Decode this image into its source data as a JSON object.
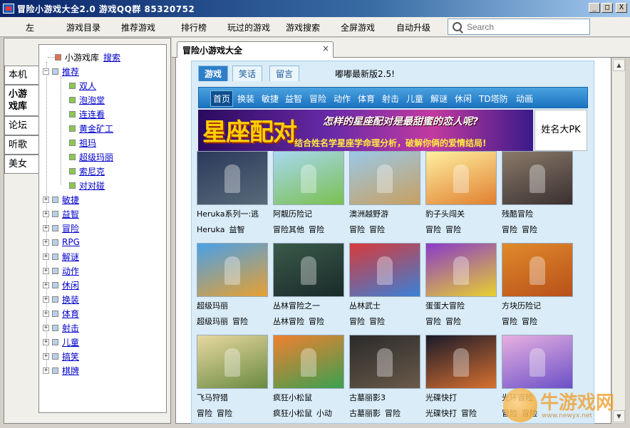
{
  "window": {
    "title": "冒险小游戏大全2.0  游戏QQ群 85320752",
    "buttons": [
      "_",
      "□",
      "X"
    ]
  },
  "menubar": {
    "items": [
      "左",
      "游戏目录",
      "推荐游戏",
      "排行榜",
      "玩过的游戏",
      "游戏搜索",
      "全屏游戏",
      "自动升级"
    ],
    "search_placeholder": "Search"
  },
  "left_tabs": [
    {
      "label": "本机",
      "active": false
    },
    {
      "label": "小游\n戏库",
      "active": true
    },
    {
      "label": "论坛",
      "active": false
    },
    {
      "label": "听歌",
      "active": false
    },
    {
      "label": "美女",
      "active": false
    }
  ],
  "tree": {
    "root": {
      "label": "小游戏库",
      "link": "搜索"
    },
    "recommend": {
      "label": "推荐",
      "children": [
        "双人",
        "泡泡堂",
        "连连看",
        "黄金矿工",
        "祖玛",
        "超级玛丽",
        "索尼克",
        "对对碰"
      ]
    },
    "categories": [
      "敏捷",
      "益智",
      "冒险",
      "RPG",
      "解谜",
      "动作",
      "休闲",
      "换装",
      "体育",
      "射击",
      "儿童",
      "搞笑",
      "棋牌"
    ]
  },
  "doc_tab": {
    "label": "冒险小游戏大全",
    "close": "×"
  },
  "panel": {
    "tabs": [
      "游戏",
      "笑话",
      "留言"
    ],
    "notice": "嘟嘟最新版2.5!",
    "categories": [
      "首页",
      "换装",
      "敏捷",
      "益智",
      "冒险",
      "动作",
      "体育",
      "射击",
      "儿童",
      "解谜",
      "休闲",
      "TD塔防",
      "动画"
    ],
    "banner": {
      "title": "星座配对",
      "line1": "怎样的星座配对是最甜蜜的恋人呢?",
      "line2": "结合姓名学星座学命理分析，破解你俩的爱情结局!",
      "side": "姓名大PK"
    },
    "games": [
      {
        "title": "Heruka系列一:逃",
        "tags": [
          "Heruka",
          "益智"
        ],
        "colors": [
          "#2a3a5a",
          "#5a6a7a"
        ]
      },
      {
        "title": "阿靓历险记",
        "tags": [
          "冒险其他",
          "冒险"
        ],
        "colors": [
          "#a8d8f0",
          "#7ac050"
        ]
      },
      {
        "title": "澳洲越野游",
        "tags": [
          "冒险",
          "冒险"
        ],
        "colors": [
          "#9bc8e8",
          "#c8a060"
        ]
      },
      {
        "title": "豹子头闯关",
        "tags": [
          "冒险",
          "冒险"
        ],
        "colors": [
          "#fff0a0",
          "#e08030"
        ]
      },
      {
        "title": "残酷冒险",
        "tags": [
          "冒险",
          "冒险"
        ],
        "colors": [
          "#8a7a6a",
          "#3a3030"
        ]
      },
      {
        "title": "超级玛丽",
        "tags": [
          "超级玛丽",
          "冒险"
        ],
        "colors": [
          "#4aa0e8",
          "#e8a030"
        ]
      },
      {
        "title": "丛林冒险之一",
        "tags": [
          "丛林冒险",
          "冒险"
        ],
        "colors": [
          "#3a5a4a",
          "#1a2a2a"
        ]
      },
      {
        "title": "丛林武士",
        "tags": [
          "冒险",
          "冒险"
        ],
        "colors": [
          "#d83a3a",
          "#3a80d8"
        ]
      },
      {
        "title": "蛋蛋大冒险",
        "tags": [
          "冒险",
          "冒险"
        ],
        "colors": [
          "#8a3ac8",
          "#e8d030"
        ]
      },
      {
        "title": "方块历险记",
        "tags": [
          "冒险",
          "冒险"
        ],
        "colors": [
          "#e08a2a",
          "#b8501a"
        ]
      },
      {
        "title": "飞马狩猎",
        "tags": [
          "冒险",
          "冒险"
        ],
        "colors": [
          "#e8d8a0",
          "#6a8a40"
        ]
      },
      {
        "title": "疯狂小松鼠",
        "tags": [
          "疯狂小松鼠",
          "小动"
        ],
        "colors": [
          "#f08030",
          "#3aa050"
        ]
      },
      {
        "title": "古墓丽影3",
        "tags": [
          "古墓丽影",
          "冒险"
        ],
        "colors": [
          "#2a2a2a",
          "#6a5a4a"
        ]
      },
      {
        "title": "光碟快打",
        "tags": [
          "光碟快打",
          "冒险"
        ],
        "colors": [
          "#1a1a2a",
          "#d87030"
        ]
      },
      {
        "title": "光环冒险",
        "tags": [
          "冒险",
          "冒险"
        ],
        "colors": [
          "#e8b0e0",
          "#6a50c8"
        ]
      }
    ]
  },
  "watermark": {
    "text": "牛游戏网",
    "url": "www.newyx.net"
  },
  "colors": {
    "accent": "#1b73c0",
    "link": "#0000cc",
    "titlebar": "#0a246a"
  }
}
